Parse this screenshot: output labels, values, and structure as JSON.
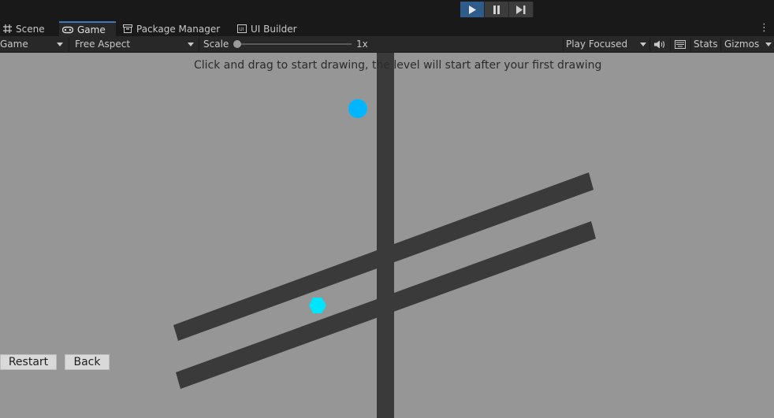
{
  "play_controls": {
    "play_icon": "play-icon",
    "pause_icon": "pause-icon",
    "step_icon": "step-icon",
    "play_active": true
  },
  "tabs": [
    {
      "label": "Scene",
      "icon": "grid-icon"
    },
    {
      "label": "Game",
      "icon": "gamepad-icon",
      "active": true
    },
    {
      "label": "Package Manager",
      "icon": "package-icon"
    },
    {
      "label": "UI Builder",
      "icon": "ui-builder-icon"
    }
  ],
  "game_toolbar": {
    "display": "Game",
    "aspect": "Free Aspect",
    "scale_label": "Scale",
    "scale_value": "1x",
    "play_mode": "Play Focused",
    "audio_icon": "speaker-icon",
    "keyboard_icon": "keyboard-icon",
    "stats_label": "Stats",
    "gizmos_label": "Gizmos"
  },
  "game": {
    "instruction": "Click and drag to start drawing, the level will start after your first drawing",
    "restart_label": "Restart",
    "back_label": "Back",
    "colors": {
      "background": "#969696",
      "walls": "#3a3a3a",
      "ball": "#00b7ff",
      "goal": "#00e5ff"
    }
  }
}
